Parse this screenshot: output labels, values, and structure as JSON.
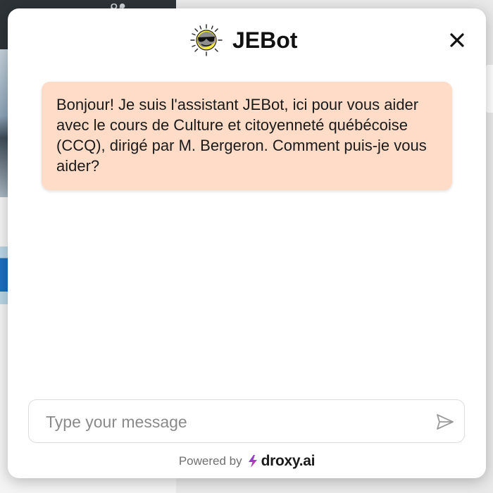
{
  "header": {
    "title": "JEBot",
    "close_icon": "close-icon",
    "avatar_icon": "sun-with-sunglasses-icon"
  },
  "messages": [
    {
      "sender": "bot",
      "text": "Bonjour! Je suis l'assistant JEBot, ici pour vous aider avec le cours de Culture et citoyenneté québécoise (CCQ), dirigé par M. Bergeron. Comment puis-je vous aider?"
    }
  ],
  "composer": {
    "value": "",
    "placeholder": "Type your message",
    "send_icon": "send-icon"
  },
  "footer": {
    "powered_by": "Powered by",
    "brand": "droxy.ai"
  },
  "colors": {
    "bubble_background": "#ffdcc7",
    "brand_gradient_start": "#6a3de8",
    "brand_gradient_end": "#e9349a"
  }
}
